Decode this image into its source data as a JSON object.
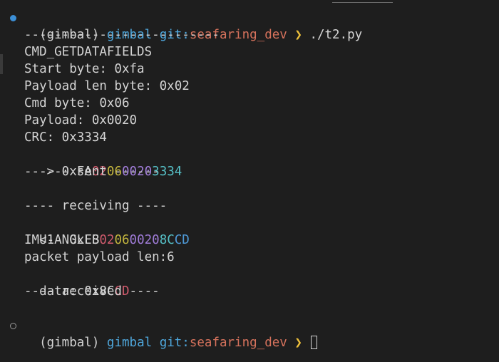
{
  "prompt1": {
    "env": "(gimbal)",
    "dir": "gimbal",
    "git_label": "git:",
    "branch": "seafaring_dev",
    "chevron": "❯",
    "command": "./t2.py",
    "status": "success"
  },
  "output": {
    "separator": "--------------------------",
    "cmd_name": "CMD_GETDATAFIELDS",
    "start_byte": "Start byte: 0xfa",
    "payload_len": "Payload len byte: 0x02",
    "cmd_byte": "Cmd byte: 0x06",
    "payload": "Payload: 0x0020",
    "crc": "CRC: 0x3334",
    "tx_packet": {
      "prefix": "-> 0x",
      "segments": [
        {
          "text": "FA",
          "color": "#d4d4d4"
        },
        {
          "text": "02",
          "color": "#d05b6d"
        },
        {
          "text": "06",
          "color": "#c4b63e"
        },
        {
          "text": "00",
          "color": "#a07cd8"
        },
        {
          "text": "20",
          "color": "#a07cd8"
        },
        {
          "text": "3334",
          "color": "#56c0c7"
        }
      ]
    },
    "sent": "------ sent ------",
    "receiving": "---- receiving ----",
    "rx_packet": {
      "prefix": "<-  0x",
      "segments": [
        {
          "text": "FB",
          "color": "#d4d4d4"
        },
        {
          "text": "02",
          "color": "#d05b6d"
        },
        {
          "text": "06",
          "color": "#c4b63e"
        },
        {
          "text": "00",
          "color": "#a07cd8"
        },
        {
          "text": "20",
          "color": "#a07cd8"
        },
        {
          "text": "8C",
          "color": "#56c0c7"
        },
        {
          "text": "CD",
          "color": "#4f9bd9"
        }
      ]
    },
    "rx_name": "IMU1ANGLES",
    "rx_len": "packet payload len:6",
    "rx_data": {
      "prefix": "data: 0x",
      "segments": [
        {
          "text": "8C",
          "color": "#d4d4d4"
        },
        {
          "text": "CD",
          "color": "#d05b6d"
        }
      ]
    },
    "received": "---- received ----"
  },
  "prompt2": {
    "env": "(gimbal)",
    "dir": "gimbal",
    "git_label": "git:",
    "branch": "seafaring_dev",
    "chevron": "❯",
    "status": "idle"
  }
}
